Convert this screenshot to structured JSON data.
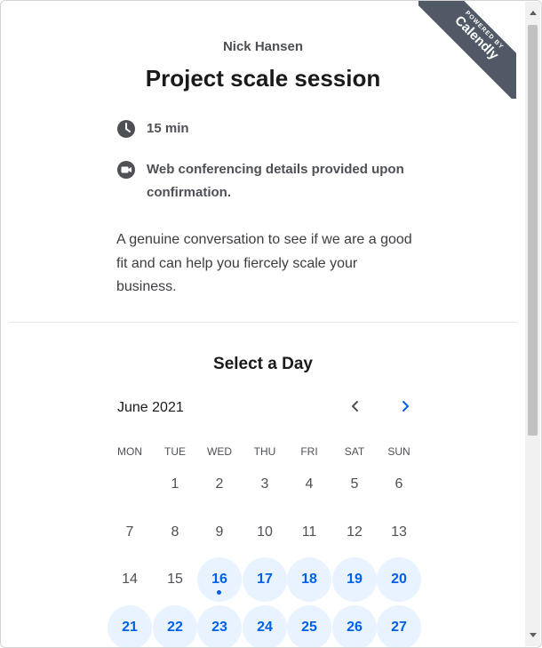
{
  "host": "Nick Hansen",
  "title": "Project scale session",
  "ribbon": {
    "small": "POWERED BY",
    "brand": "Calendly"
  },
  "details": {
    "duration": "15 min",
    "location": "Web conferencing details provided upon confirmation."
  },
  "description": "A genuine conversation to see if we are a good fit and can help you fiercely scale your business.",
  "select_day": "Select a Day",
  "calendar": {
    "month": "June 2021",
    "weekdays": [
      "MON",
      "TUE",
      "WED",
      "THU",
      "FRI",
      "SAT",
      "SUN"
    ],
    "week1": [
      "1",
      "2",
      "3",
      "4",
      "5",
      "6"
    ],
    "week2": [
      "7",
      "8",
      "9",
      "10",
      "11",
      "12",
      "13"
    ],
    "week3": [
      "14",
      "15",
      "16",
      "17",
      "18",
      "19",
      "20"
    ],
    "week4": [
      "21",
      "22",
      "23",
      "24",
      "25",
      "26",
      "27"
    ]
  },
  "icons": {
    "duration": "clock-icon",
    "location": "video-camera-icon",
    "prev": "chevron-left-icon",
    "next": "chevron-right-icon"
  },
  "colors": {
    "accent": "#0060e6",
    "available_bg": "#e9f3ff",
    "ribbon": "#505965"
  }
}
